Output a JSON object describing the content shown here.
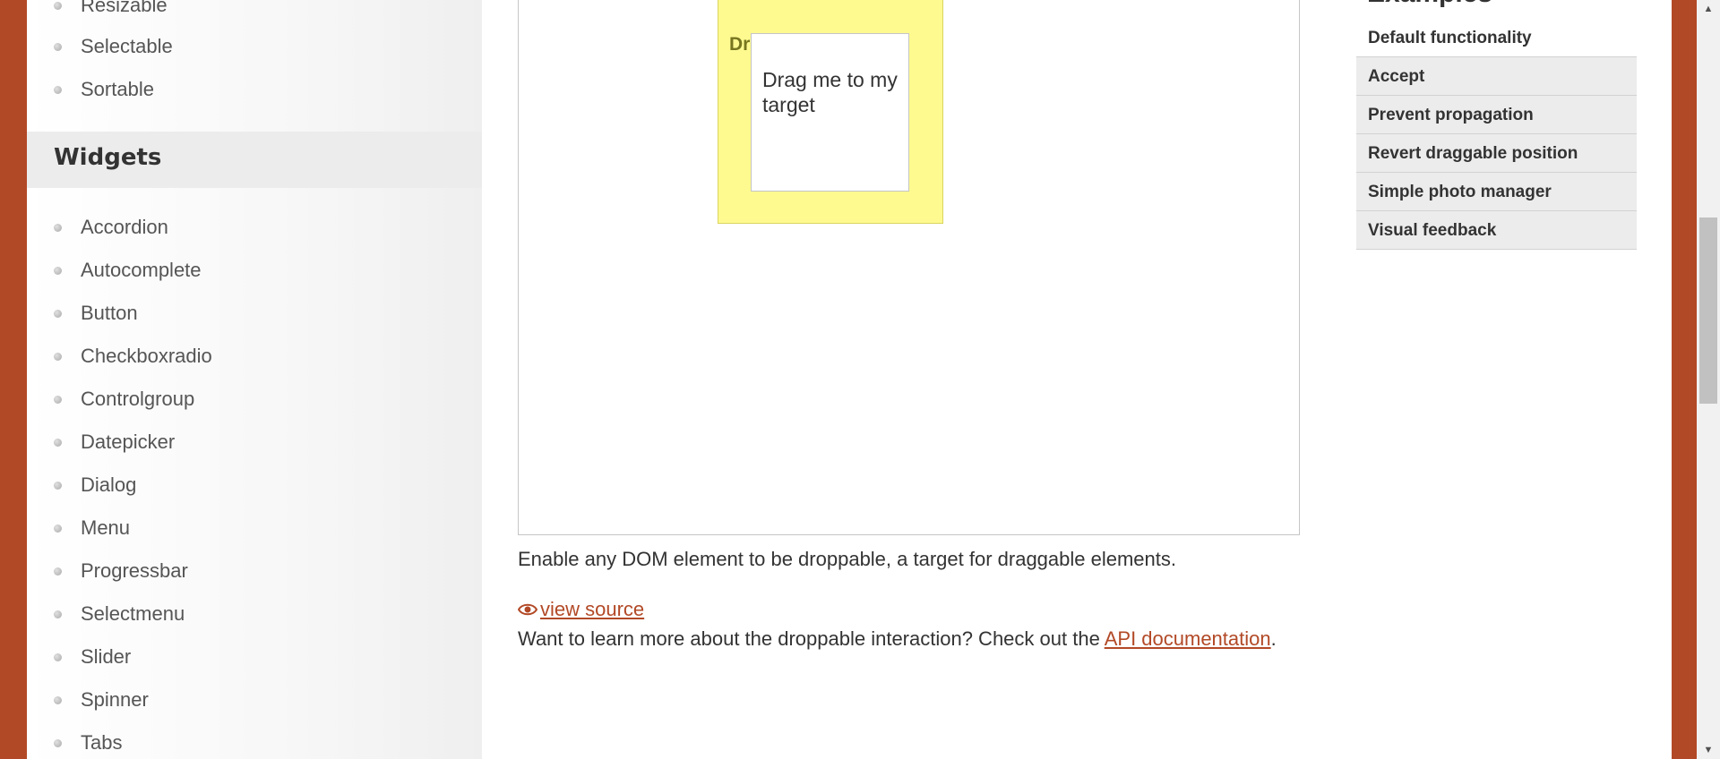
{
  "sidebar": {
    "interactions_tail": [
      "Resizable",
      "Selectable",
      "Sortable"
    ],
    "widgets_header": "Widgets",
    "widgets": [
      "Accordion",
      "Autocomplete",
      "Button",
      "Checkboxradio",
      "Controlgroup",
      "Datepicker",
      "Dialog",
      "Menu",
      "Progressbar",
      "Selectmenu",
      "Slider",
      "Spinner",
      "Tabs"
    ]
  },
  "demo": {
    "droppable_label": "Drop here",
    "draggable_label": "Drag me to my target"
  },
  "main": {
    "description": "Enable any DOM element to be droppable, a target for draggable elements.",
    "view_source": "view source",
    "learn_more_prefix": "Want to learn more about the droppable interaction? Check out the ",
    "api_link": "API documentation",
    "learn_more_suffix": "."
  },
  "examples": {
    "title": "Examples",
    "items": [
      "Default functionality",
      "Accept",
      "Prevent propagation",
      "Revert draggable position",
      "Simple photo manager",
      "Visual feedback"
    ]
  },
  "colors": {
    "accent": "#b24926",
    "droppable_bg": "#fffa90",
    "nav_bg": "#ececec"
  }
}
